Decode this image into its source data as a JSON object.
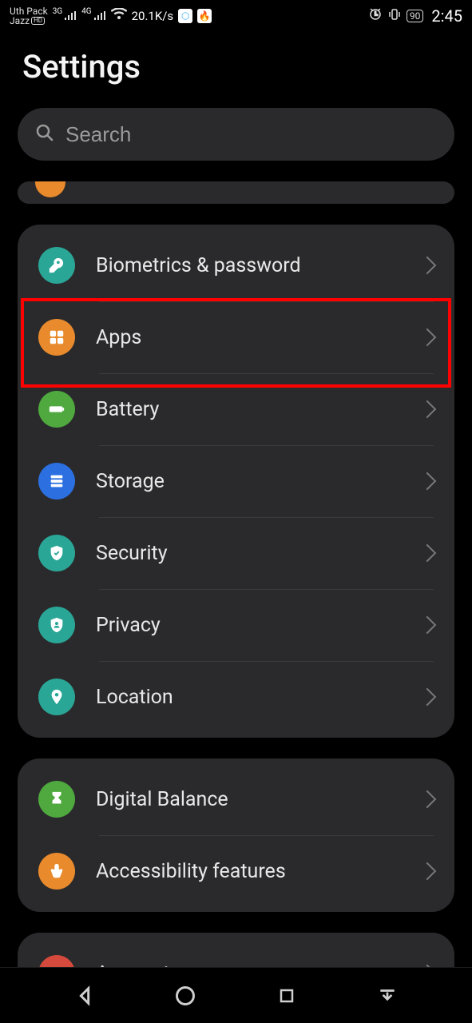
{
  "status_bar": {
    "carrier_top": "Uth Pack",
    "carrier_bottom": "Jazz",
    "hd": "HD",
    "net1_sup": "3G",
    "net2_sup": "4G",
    "speed": "20.1K/s",
    "battery_pct": "90",
    "time": "2:45"
  },
  "page": {
    "title": "Settings"
  },
  "search": {
    "placeholder": "Search"
  },
  "group1": [
    {
      "label": "Biometrics & password",
      "icon": "key",
      "color": "teal"
    },
    {
      "label": "Apps",
      "icon": "grid",
      "color": "orange"
    },
    {
      "label": "Battery",
      "icon": "battery",
      "color": "green"
    },
    {
      "label": "Storage",
      "icon": "stack",
      "color": "blue"
    },
    {
      "label": "Security",
      "icon": "shield",
      "color": "teal"
    },
    {
      "label": "Privacy",
      "icon": "pshield",
      "color": "teal"
    },
    {
      "label": "Location",
      "icon": "pin",
      "color": "teal"
    }
  ],
  "group2": [
    {
      "label": "Digital Balance",
      "icon": "hourglass",
      "color": "green"
    },
    {
      "label": "Accessibility features",
      "icon": "hand",
      "color": "orange"
    }
  ],
  "group3": [
    {
      "label": "Accounts",
      "icon": "person",
      "color": "red"
    }
  ]
}
